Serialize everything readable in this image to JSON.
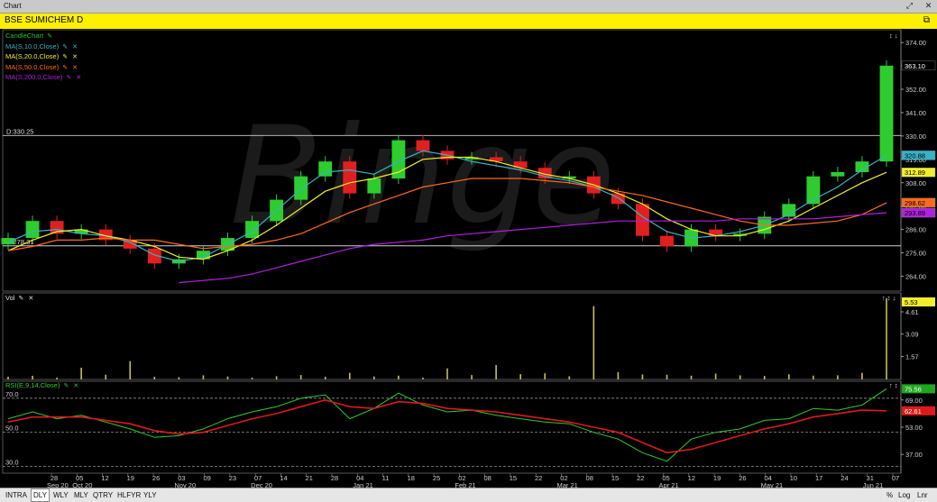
{
  "window": {
    "title": "Chart"
  },
  "symbol_bar": {
    "label": "BSE SUMICHEM D"
  },
  "price_panel": {
    "legend": [
      {
        "label": "CandleChart",
        "color": "#27c227"
      },
      {
        "label": "MA(S,10.0,Close)",
        "color": "#35b3c7"
      },
      {
        "label": "MA(S,20.0,Close)",
        "color": "#f2ee2c"
      },
      {
        "label": "MA(S,50.0,Close)",
        "color": "#ff6a1a"
      },
      {
        "label": "MA(S,200.0,Close)",
        "color": "#b020e0"
      }
    ],
    "hline_labels": [
      "D:330.25",
      "D:278.31"
    ],
    "axis_ticks": [
      "374.00",
      "363.10",
      "352.00",
      "341.00",
      "330.00",
      "319.00",
      "308.00",
      "297.00",
      "286.00",
      "275.00",
      "264.00"
    ],
    "badges": [
      {
        "text": "363.10",
        "color": "#000000",
        "text_color": "#ffffff"
      },
      {
        "text": "320.88",
        "color": "#35b3c7",
        "text_color": "#000000"
      },
      {
        "text": "312.89",
        "color": "#f2ee2c",
        "text_color": "#000000"
      },
      {
        "text": "298.62",
        "color": "#ff6a1a",
        "text_color": "#000000"
      },
      {
        "text": "293.89",
        "color": "#b020e0",
        "text_color": "#000000"
      }
    ],
    "panel_icons": "↕ ↓",
    "watermark": "Binge"
  },
  "volume_panel": {
    "legend": "Vol",
    "axis_ticks": [
      "4.61",
      "3.09",
      "1.57"
    ],
    "badge": "5.53",
    "panel_icons": "↑ ↕ ↓"
  },
  "rsi_panel": {
    "legend": "RSI(E,9,14,Close)",
    "hline_labels": [
      "70.0",
      "50.0",
      "30.0"
    ],
    "axis_ticks": [
      "69.00",
      "53.00",
      "37.00"
    ],
    "badges": [
      {
        "text": "75.56",
        "color": "#1fa81f"
      },
      {
        "text": "62.61",
        "color": "#e01818"
      }
    ],
    "panel_icons": "↑ ↕"
  },
  "x_axis": {
    "days": [
      "28",
      "05",
      "12",
      "19",
      "26",
      "03",
      "09",
      "23",
      "07",
      "14",
      "21",
      "28",
      "04",
      "11",
      "18",
      "25",
      "02",
      "08",
      "15",
      "22",
      "02",
      "08",
      "15",
      "22",
      "05",
      "12",
      "19",
      "26",
      "04",
      "10",
      "17",
      "24",
      "31",
      "07"
    ],
    "months": [
      "Sep 20",
      "Oct 20",
      "Nov 20",
      "Dec 20",
      "Jan 21",
      "Feb 21",
      "Mar 21",
      "Apr 21",
      "May 21",
      "Jun 21"
    ]
  },
  "bottom_bar": {
    "tabs": [
      "INTRA",
      "DLY",
      "WLY",
      "MLY",
      "QTRY",
      "HLFYR",
      "YLY"
    ],
    "selected_tab": "DLY",
    "right": [
      "%",
      "Log",
      "Lnr"
    ]
  },
  "chart_data": [
    {
      "type": "candlestick",
      "title": "BSE SUMICHEM D",
      "x": [
        "2020-09-24",
        "2020-10-01",
        "2020-10-08",
        "2020-10-15",
        "2020-10-22",
        "2020-10-29",
        "2020-11-05",
        "2020-11-12",
        "2020-11-19",
        "2020-11-26",
        "2020-12-03",
        "2020-12-10",
        "2020-12-17",
        "2020-12-24",
        "2020-12-31",
        "2021-01-07",
        "2021-01-14",
        "2021-01-21",
        "2021-01-28",
        "2021-02-04",
        "2021-02-11",
        "2021-02-18",
        "2021-02-25",
        "2021-03-04",
        "2021-03-11",
        "2021-03-18",
        "2021-03-25",
        "2021-04-01",
        "2021-04-08",
        "2021-04-15",
        "2021-04-22",
        "2021-04-29",
        "2021-05-06",
        "2021-05-13",
        "2021-05-20",
        "2021-05-27",
        "2021-06-01"
      ],
      "close": [
        282,
        290,
        284,
        286,
        281,
        277,
        270,
        272,
        276,
        282,
        290,
        300,
        311,
        318,
        303,
        310,
        328,
        323,
        319,
        320,
        318,
        315,
        310,
        311,
        303,
        298,
        283,
        278,
        286,
        283,
        284,
        292,
        298,
        311,
        313,
        318,
        363.1
      ],
      "series": [
        {
          "name": "MA(S,10.0,Close)",
          "values": [
            280,
            285,
            286,
            284,
            283,
            280,
            274,
            271,
            273,
            279,
            285,
            295,
            305,
            313,
            314,
            312,
            318,
            323,
            321,
            318,
            316,
            314,
            311,
            309,
            306,
            301,
            292,
            285,
            282,
            283,
            285,
            288,
            293,
            300,
            306,
            314,
            320.88
          ]
        },
        {
          "name": "MA(S,20.0,Close)",
          "values": [
            276,
            281,
            285,
            286,
            283,
            281,
            278,
            273,
            272,
            276,
            281,
            288,
            296,
            304,
            308,
            310,
            313,
            319,
            320,
            320,
            318,
            315,
            312,
            310,
            307,
            303,
            298,
            291,
            286,
            283,
            283,
            286,
            290,
            296,
            302,
            308,
            312.89
          ]
        },
        {
          "name": "MA(S,50.0,Close)",
          "values": [
            276,
            278,
            281,
            281,
            282,
            281,
            281,
            279,
            277,
            278,
            279,
            281,
            284,
            289,
            294,
            298,
            302,
            306,
            308,
            310,
            310,
            310,
            309,
            308,
            306,
            304,
            302,
            299,
            296,
            293,
            290,
            288,
            288,
            289,
            290,
            293,
            298.62
          ]
        },
        {
          "name": "MA(S,200.0,Close)",
          "values": [
            null,
            null,
            null,
            null,
            null,
            null,
            null,
            261,
            262,
            263,
            265,
            268,
            271,
            274,
            277,
            279,
            280,
            281,
            283,
            284,
            285,
            286,
            287,
            288,
            289,
            290,
            290,
            290,
            290,
            290,
            291,
            291,
            291,
            291,
            292,
            293,
            293.89
          ]
        }
      ],
      "ylim": [
        257,
        380
      ],
      "horizontal_lines": [
        330.25,
        278.31
      ]
    },
    {
      "type": "bar",
      "title": "Vol",
      "values": [
        0.18,
        0.25,
        0.12,
        0.8,
        0.32,
        1.25,
        0.18,
        0.15,
        0.28,
        0.2,
        0.12,
        0.22,
        0.3,
        0.18,
        0.45,
        0.2,
        0.26,
        0.12,
        0.75,
        0.3,
        0.98,
        0.36,
        0.42,
        0.22,
        5.0,
        0.5,
        0.34,
        0.32,
        0.26,
        0.4,
        0.28,
        0.24,
        0.35,
        0.26,
        0.28,
        0.45,
        5.53
      ],
      "ylim": [
        0,
        5.9
      ]
    },
    {
      "type": "line",
      "title": "RSI(E,9,14,Close)",
      "series": [
        {
          "name": "RSI",
          "values": [
            58,
            62,
            58,
            60,
            56,
            52,
            47,
            48,
            52,
            58,
            62,
            65,
            70,
            72,
            58,
            64,
            73,
            66,
            62,
            63,
            60,
            58,
            56,
            55,
            50,
            46,
            38,
            33,
            46,
            50,
            52,
            57,
            58,
            64,
            63,
            66,
            75.56
          ]
        },
        {
          "name": "Signal",
          "values": [
            56,
            59,
            59,
            59,
            57,
            55,
            51,
            49,
            50,
            54,
            58,
            61,
            65,
            69,
            65,
            64,
            68,
            67,
            64,
            63,
            62,
            60,
            58,
            56,
            53,
            50,
            44,
            38,
            40,
            44,
            48,
            52,
            55,
            59,
            61,
            63,
            62.61
          ]
        }
      ],
      "ylim": [
        26,
        80
      ],
      "horizontal_lines": [
        70,
        50,
        30
      ]
    }
  ]
}
